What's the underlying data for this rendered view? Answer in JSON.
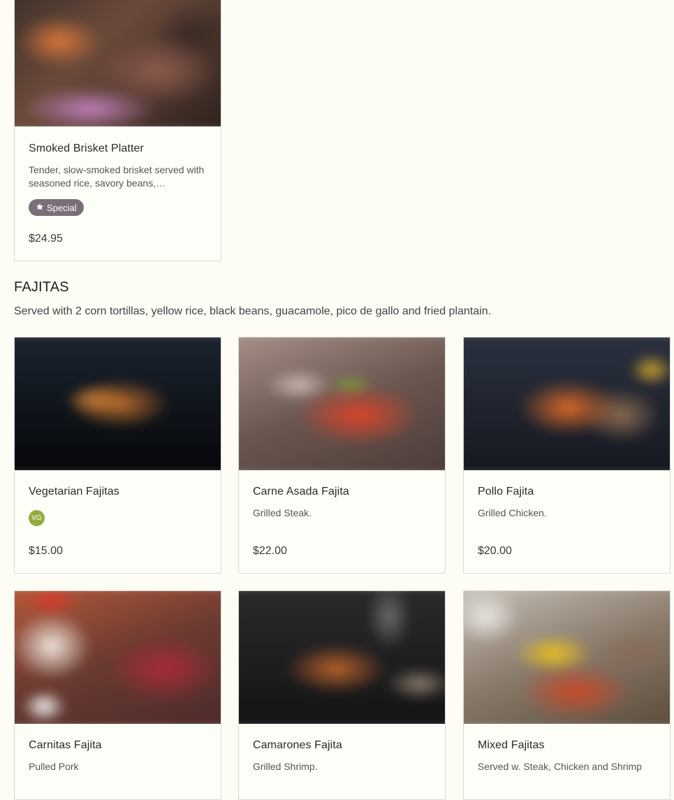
{
  "featured": {
    "title": "Smoked Brisket Platter",
    "description": "Tender, slow-smoked brisket served with seasoned rice, savory beans,…",
    "badge": "Special",
    "badge_icon": "star-icon",
    "price": "$24.95"
  },
  "section": {
    "title": "FAJITAS",
    "description": "Served with 2 corn tortillas, yellow rice, black beans, guacamole, pico de gallo and fried plantain."
  },
  "items": [
    {
      "title": "Vegetarian Fajitas",
      "description": "",
      "badge": "VG",
      "price": "$15.00"
    },
    {
      "title": "Carne Asada Fajita",
      "description": "Grilled Steak.",
      "badge": "",
      "price": "$22.00"
    },
    {
      "title": "Pollo Fajita",
      "description": "Grilled Chicken.",
      "badge": "",
      "price": "$20.00"
    },
    {
      "title": "Carnitas Fajita",
      "description": "Pulled Pork",
      "badge": "",
      "price": ""
    },
    {
      "title": "Camarones Fajita",
      "description": "Grilled Shrimp.",
      "badge": "",
      "price": ""
    },
    {
      "title": "Mixed Fajitas",
      "description": "Served w. Steak, Chicken and Shrimp",
      "badge": "",
      "price": ""
    }
  ],
  "colors": {
    "background": "#fdfdf5",
    "card_border": "#d9d9d3",
    "special_badge": "#7a6f78",
    "vg_badge": "#94ad3f"
  }
}
